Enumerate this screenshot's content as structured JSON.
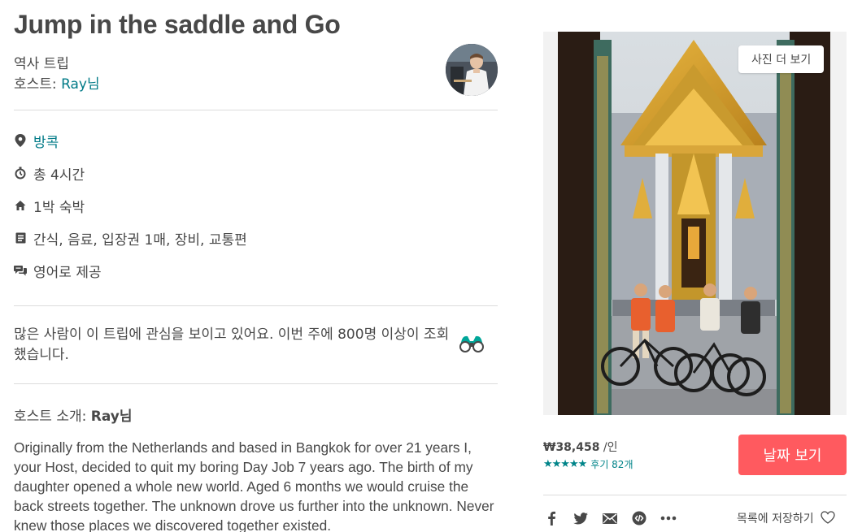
{
  "header": {
    "title": "Jump in the saddle and Go",
    "category": "역사 트립",
    "host_prefix": "호스트: ",
    "host_name": "Ray님"
  },
  "facts": [
    {
      "icon": "map-pin-icon",
      "text": "방콕"
    },
    {
      "icon": "clock-icon",
      "text": "총 4시간"
    },
    {
      "icon": "home-icon",
      "text": "1박 숙박"
    },
    {
      "icon": "receipt-icon",
      "text": "간식, 음료, 입장권 1매, 장비, 교통편"
    },
    {
      "icon": "chat-icon",
      "text": "영어로 제공"
    }
  ],
  "interest": {
    "text": "많은 사람이 이 트립에 관심을 보이고 있어요. 이번 주에 800명 이상이 조회했습니다."
  },
  "host_section": {
    "heading_prefix": "호스트 소개: ",
    "heading_name": "Ray님",
    "bio": "Originally from the Netherlands and based in Bangkok for over 21 years I, your Host, decided to quit my boring Day Job 7 years ago. The birth of my daughter opened a whole new world. Aged 6 months we would cruise the back streets together. The unknown drove us further into the unknown. Never knew those places we discovered together existed."
  },
  "photo": {
    "more_button": "사진 더 보기"
  },
  "booking": {
    "price": "₩38,458",
    "per": " /인",
    "stars": "★★★★★",
    "reviews": "후기 82개",
    "button": "날짜 보기"
  },
  "share": {
    "icons": [
      "facebook-icon",
      "twitter-icon",
      "email-icon",
      "embed-icon",
      "more-icon"
    ],
    "save_label": "목록에 저장하기"
  },
  "colors": {
    "accent_teal": "#008489",
    "link": "#007a87",
    "cta": "#ff5a5f",
    "text": "#484848"
  }
}
